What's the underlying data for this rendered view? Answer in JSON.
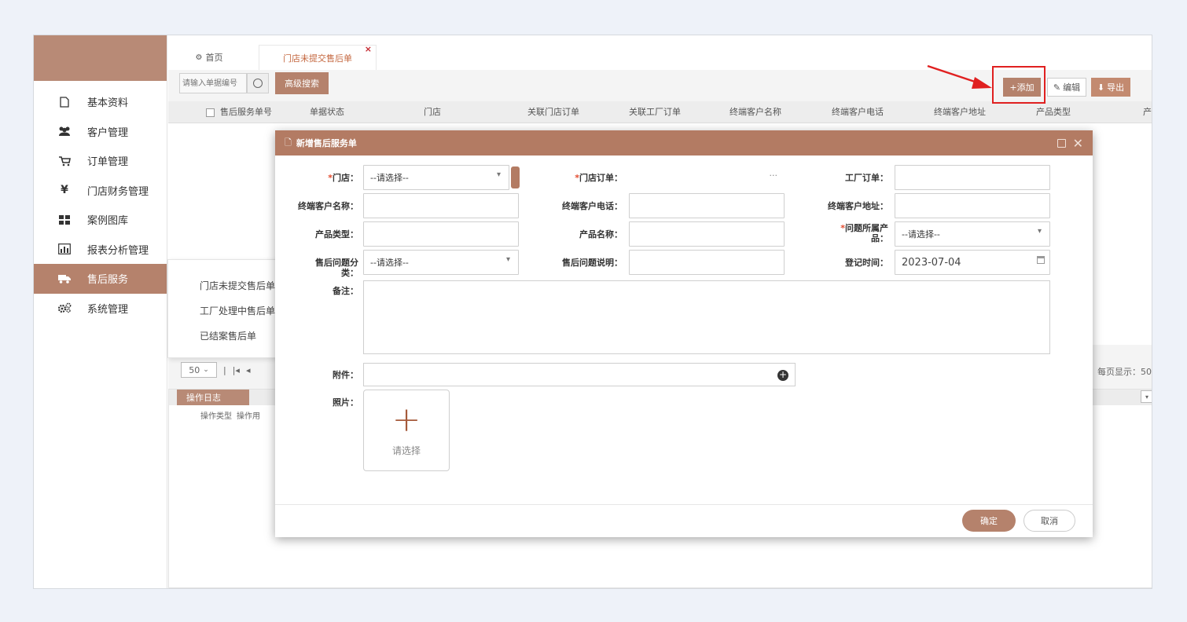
{
  "sidebar": {
    "items": [
      {
        "label": "基本资料",
        "icon": "file-icon"
      },
      {
        "label": "客户管理",
        "icon": "users-icon"
      },
      {
        "label": "订单管理",
        "icon": "cart-icon"
      },
      {
        "label": "门店财务管理",
        "icon": "yen-icon"
      },
      {
        "label": "案例图库",
        "icon": "grid-icon"
      },
      {
        "label": "报表分析管理",
        "icon": "bar-chart-icon"
      },
      {
        "label": "售后服务",
        "icon": "truck-icon"
      },
      {
        "label": "系统管理",
        "icon": "gears-icon"
      }
    ],
    "submenu": [
      "门店未提交售后单",
      "工厂处理中售后单",
      "已结案售后单"
    ]
  },
  "tabs": {
    "home": "首页",
    "active": "门店未提交售后单",
    "close": "×"
  },
  "toolbar": {
    "search_placeholder": "请输入单据编号",
    "advanced": "高级搜索",
    "add": "+添加",
    "edit": "编辑",
    "export": "导出"
  },
  "grid": {
    "columns": [
      "售后服务单号",
      "单据状态",
      "门店",
      "关联门店订单",
      "关联工厂订单",
      "终端客户名称",
      "终端客户电话",
      "终端客户地址",
      "产品类型",
      "产"
    ]
  },
  "pager": {
    "page_size": "50",
    "right_text": "每页显示：50"
  },
  "log": {
    "tab": "操作日志",
    "columns": [
      "操作类型",
      "操作用"
    ]
  },
  "modal": {
    "title": "新增售后服务单",
    "fields": {
      "store_label": "门店：",
      "store_value": "--请选择--",
      "store_order_label": "门店订单：",
      "store_order_more": "···",
      "factory_order_label": "工厂订单：",
      "customer_name_label": "终端客户名称：",
      "customer_phone_label": "终端客户电话：",
      "customer_address_label": "终端客户地址：",
      "product_type_label": "产品类型：",
      "product_name_label": "产品名称：",
      "problem_product_label_1": "问题所属产",
      "problem_product_label_2": "品：",
      "problem_product_value": "--请选择--",
      "problem_category_label_1": "售后问题分",
      "problem_category_label_2": "类：",
      "problem_category_value": "--请选择--",
      "problem_desc_label": "售后问题说明：",
      "register_time_label": "登记时间：",
      "register_time_value": "2023-07-04",
      "remarks_label": "备注：",
      "attachment_label": "附件：",
      "photo_label": "照片：",
      "photo_placeholder": "请选择"
    },
    "ok": "确定",
    "cancel": "取消"
  },
  "colors": {
    "accent": "#b5826c",
    "header": "#b37b63",
    "highlight": "#e02020"
  }
}
